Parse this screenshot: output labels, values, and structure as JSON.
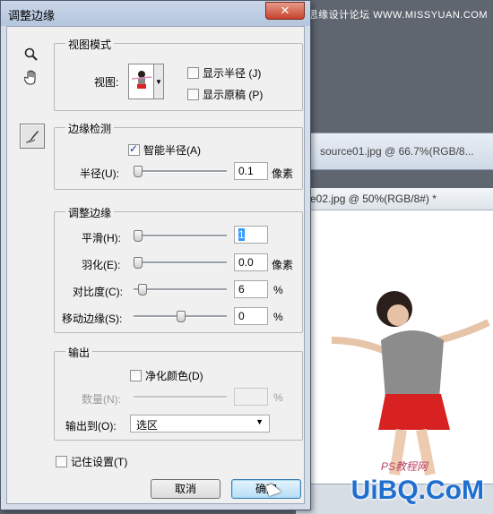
{
  "dialog": {
    "title": "调整边缘",
    "close_icon": "close-icon",
    "tools": {
      "zoom_icon": "zoom-icon",
      "hand_icon": "hand-icon",
      "brush_icon": "refine-radius-brush-icon"
    },
    "view_mode": {
      "legend": "视图模式",
      "view_label": "视图:",
      "show_radius": "显示半径 (J)",
      "show_original": "显示原稿 (P)"
    },
    "edge_detection": {
      "legend": "边缘检测",
      "smart_radius": "智能半径(A)",
      "radius_label": "半径(U):",
      "radius_value": "0.1",
      "radius_unit": "像素"
    },
    "adjust_edge": {
      "legend": "调整边缘",
      "smooth_label": "平滑(H):",
      "smooth_value": "1",
      "feather_label": "羽化(E):",
      "feather_value": "0.0",
      "feather_unit": "像素",
      "contrast_label": "对比度(C):",
      "contrast_value": "6",
      "contrast_unit": "%",
      "shift_label": "移动边缘(S):",
      "shift_value": "0",
      "shift_unit": "%"
    },
    "output": {
      "legend": "输出",
      "decontaminate": "净化颜色(D)",
      "amount_label": "数量(N):",
      "amount_unit": "%",
      "output_to_label": "输出到(O):",
      "output_to_value": "选区"
    },
    "remember": "记住设置(T)",
    "cancel": "取消",
    "ok": "确定"
  },
  "background": {
    "tab1": "source01.jpg @ 66.7%(RGB/8...",
    "tab2": "e02.jpg @ 50%(RGB/8#) *",
    "site": "思缘设计论坛 WWW.MISSYUAN.COM",
    "watermark": "UiBQ.CoM",
    "watermark2": "PS教程网"
  }
}
